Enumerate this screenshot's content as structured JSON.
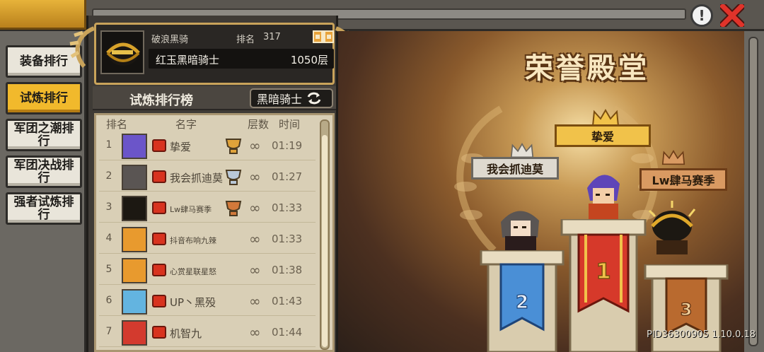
{
  "tabs": [
    {
      "label": "装备排行",
      "active": false
    },
    {
      "label": "试炼排行",
      "active": true
    },
    {
      "label": "军团之潮排行",
      "active": false
    },
    {
      "label": "军团决战排行",
      "active": false
    },
    {
      "label": "强者试炼排行",
      "active": false
    }
  ],
  "header": {
    "player_name": "破浪黑骑",
    "rank_label": "排名",
    "rank_value": "317",
    "title": "红玉黑暗骑士",
    "floor": "1050层"
  },
  "board": {
    "title": "试炼排行榜",
    "class_selector": "黑暗骑士"
  },
  "columns": {
    "rank": "排名",
    "name": "名字",
    "floors": "层数",
    "time": "时间"
  },
  "rows": [
    {
      "rank": "1",
      "name": "挚爱",
      "floors": "∞",
      "time": "01:19",
      "trophy": "gold",
      "avatar_color": "#6b55c9"
    },
    {
      "rank": "2",
      "name": "我会抓迪莫",
      "floors": "∞",
      "time": "01:27",
      "trophy": "silver",
      "avatar_color": "#5a5553"
    },
    {
      "rank": "3",
      "name": "Lw肆马赛季",
      "floors": "∞",
      "time": "01:33",
      "trophy": "bronze",
      "avatar_color": "#1c1812"
    },
    {
      "rank": "4",
      "name": "抖音布响九辣",
      "floors": "∞",
      "time": "01:33",
      "trophy": "",
      "avatar_color": "#e89a2e"
    },
    {
      "rank": "5",
      "name": "心赏星联星怒",
      "floors": "∞",
      "time": "01:38",
      "trophy": "",
      "avatar_color": "#e89a2e"
    },
    {
      "rank": "6",
      "name": "UP丶黑殁",
      "floors": "∞",
      "time": "01:43",
      "trophy": "",
      "avatar_color": "#63b4e0"
    },
    {
      "rank": "7",
      "name": "机智九",
      "floors": "∞",
      "time": "01:44",
      "trophy": "",
      "avatar_color": "#d33a2e"
    }
  ],
  "hall": {
    "title": "荣誉殿堂",
    "first": {
      "name": "挚爱",
      "place": "1"
    },
    "second": {
      "name": "我会抓迪莫",
      "place": "2"
    },
    "third": {
      "name": "Lw肆马赛季",
      "place": "3"
    }
  },
  "footer": {
    "pid": "PID36300905 1.10.0.18"
  },
  "icons": {
    "info": "!",
    "close": "close-icon",
    "swap": "swap-icon"
  },
  "colors": {
    "accent": "#f1b92c",
    "gold": "#f1c24a",
    "close_red": "#e0332a"
  }
}
